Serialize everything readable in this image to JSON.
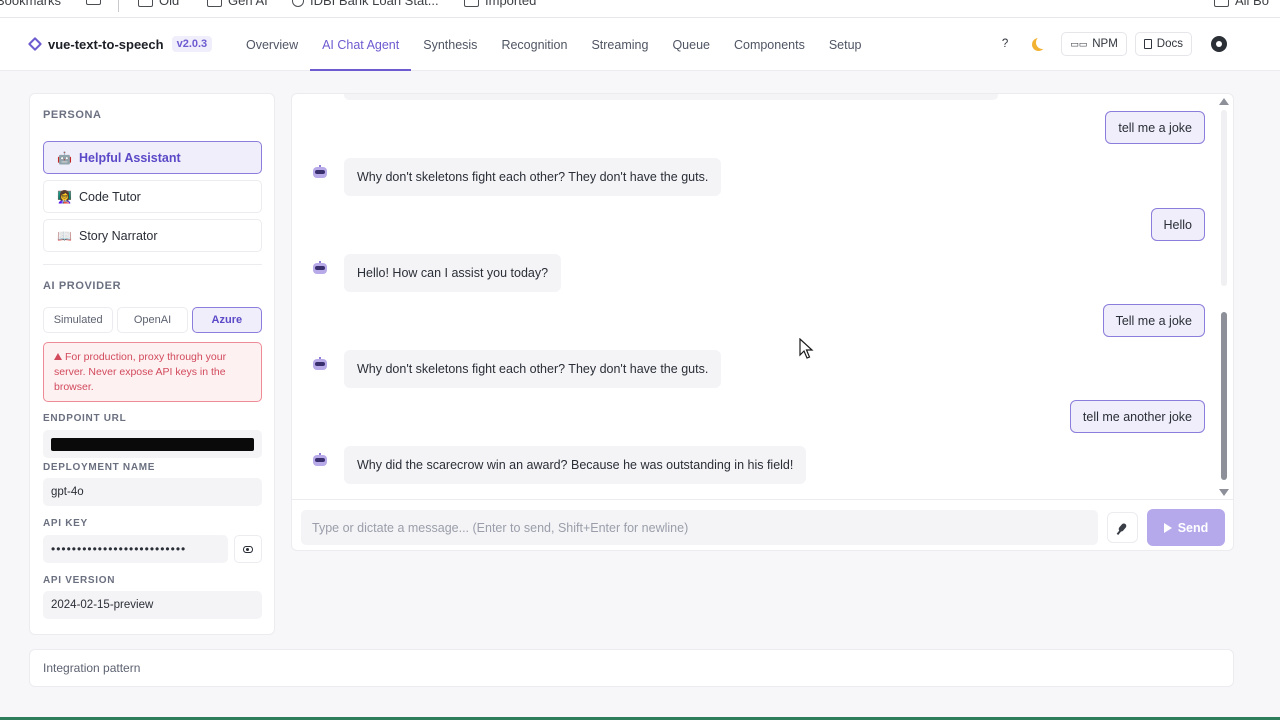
{
  "bookmarks_bar": {
    "items": [
      "Bookmarks",
      "Old",
      "Gen AI",
      "IDBI Bank Loan Stat...",
      "Imported",
      "All Bo"
    ]
  },
  "header": {
    "app_name": "vue-text-to-speech",
    "version": "v2.0.3",
    "tabs": [
      {
        "label": "Overview",
        "active": false
      },
      {
        "label": "AI Chat Agent",
        "active": true
      },
      {
        "label": "Synthesis",
        "active": false
      },
      {
        "label": "Recognition",
        "active": false
      },
      {
        "label": "Streaming",
        "active": false
      },
      {
        "label": "Queue",
        "active": false
      },
      {
        "label": "Components",
        "active": false
      },
      {
        "label": "Setup",
        "active": false
      }
    ],
    "help_label": "?",
    "npm_label": "NPM",
    "docs_label": "Docs",
    "icons": [
      "diamond-logo-icon",
      "moon-icon",
      "npm-icon",
      "docs-icon",
      "github-icon"
    ]
  },
  "sidebar": {
    "persona_title": "PERSONA",
    "personas": [
      {
        "label": "Helpful Assistant",
        "emoji": "🤖",
        "active": true
      },
      {
        "label": "Code Tutor",
        "emoji": "👩‍🏫",
        "active": false
      },
      {
        "label": "Story Narrator",
        "emoji": "📖",
        "active": false
      }
    ],
    "provider_title": "AI PROVIDER",
    "providers": [
      {
        "label": "Simulated",
        "active": false
      },
      {
        "label": "OpenAI",
        "active": false
      },
      {
        "label": "Azure",
        "active": true
      }
    ],
    "warning": "For production, proxy through your server. Never expose API keys in the browser.",
    "endpoint_label": "ENDPOINT URL",
    "endpoint_value_redacted": true,
    "deployment_label": "DEPLOYMENT NAME",
    "deployment_value": "gpt-4o",
    "api_key_label": "API KEY",
    "api_key_value": "••••••••••••••••••••••••••",
    "api_version_label": "API VERSION",
    "api_version_value": "2024-02-15-preview"
  },
  "chat": {
    "messages": [
      {
        "role": "user",
        "text": "tell me a joke"
      },
      {
        "role": "bot",
        "text": "Why don't skeletons fight each other? They don't have the guts."
      },
      {
        "role": "user",
        "text": "Hello"
      },
      {
        "role": "bot",
        "text": "Hello! How can I assist you today?"
      },
      {
        "role": "user",
        "text": "Tell me a joke"
      },
      {
        "role": "bot",
        "text": "Why don't skeletons fight each other? They don't have the guts."
      },
      {
        "role": "user",
        "text": "tell me another joke"
      },
      {
        "role": "bot",
        "text": "Why did the scarecrow win an award? Because he was outstanding in his field!"
      }
    ],
    "input_placeholder": "Type or dictate a message... (Enter to send, Shift+Enter for newline)",
    "send_label": "Send"
  },
  "integration_label": "Integration pattern",
  "colors": {
    "accent": "#6d5bd0",
    "accent_light": "#efeefa",
    "warning": "#d24a5c",
    "send_button": "#b5a9ec"
  }
}
